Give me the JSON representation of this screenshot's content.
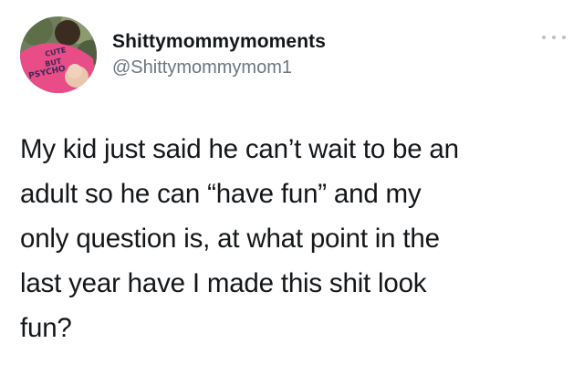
{
  "tweet": {
    "display_name": "Shittymommymoments",
    "handle": "@Shittymommymom1",
    "avatar": {
      "shirt_text": [
        "CUTE",
        "BUT",
        "PSYCHO"
      ]
    },
    "more_icon": "more-horizontal-icon",
    "text_lines": [
      "My kid just said he can’t wait to be an",
      "adult so he can “have fun” and my",
      "only question is, at what point in the",
      "last year have I made this shit look",
      "fun?"
    ]
  },
  "colors": {
    "background": "#ffffff",
    "text": "#14171a",
    "secondary_text": "#6b7680",
    "shirt": "#e84d87"
  }
}
